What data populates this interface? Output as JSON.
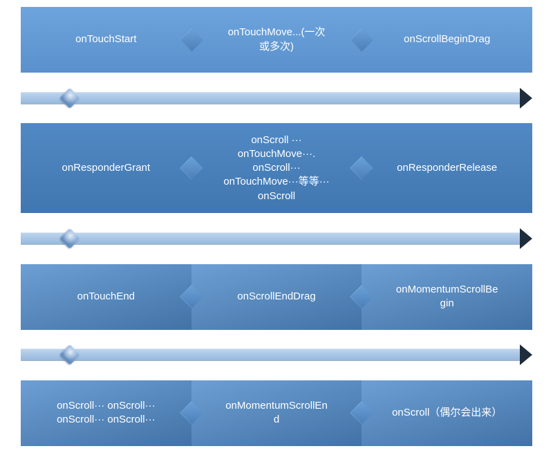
{
  "rows": [
    {
      "cells": [
        {
          "label": "onTouchStart"
        },
        {
          "label": "onTouchMove...(一次\n或多次)"
        },
        {
          "label": "onScrollBeginDrag"
        }
      ]
    },
    {
      "cells": [
        {
          "label": "onResponderGrant"
        },
        {
          "label": "onScroll ···\nonTouchMove···.\nonScroll···\nonTouchMove···等等···\nonScroll"
        },
        {
          "label": "onResponderRelease"
        }
      ]
    },
    {
      "cells": [
        {
          "label": "onTouchEnd"
        },
        {
          "label": "onScrollEndDrag"
        },
        {
          "label": "onMomentumScrollBe\ngin"
        }
      ]
    },
    {
      "cells": [
        {
          "label": "onScroll··· onScroll···\nonScroll··· onScroll···"
        },
        {
          "label": "onMomentumScrollEn\nd"
        },
        {
          "label": "onScroll（偶尔会出来）"
        }
      ]
    }
  ]
}
